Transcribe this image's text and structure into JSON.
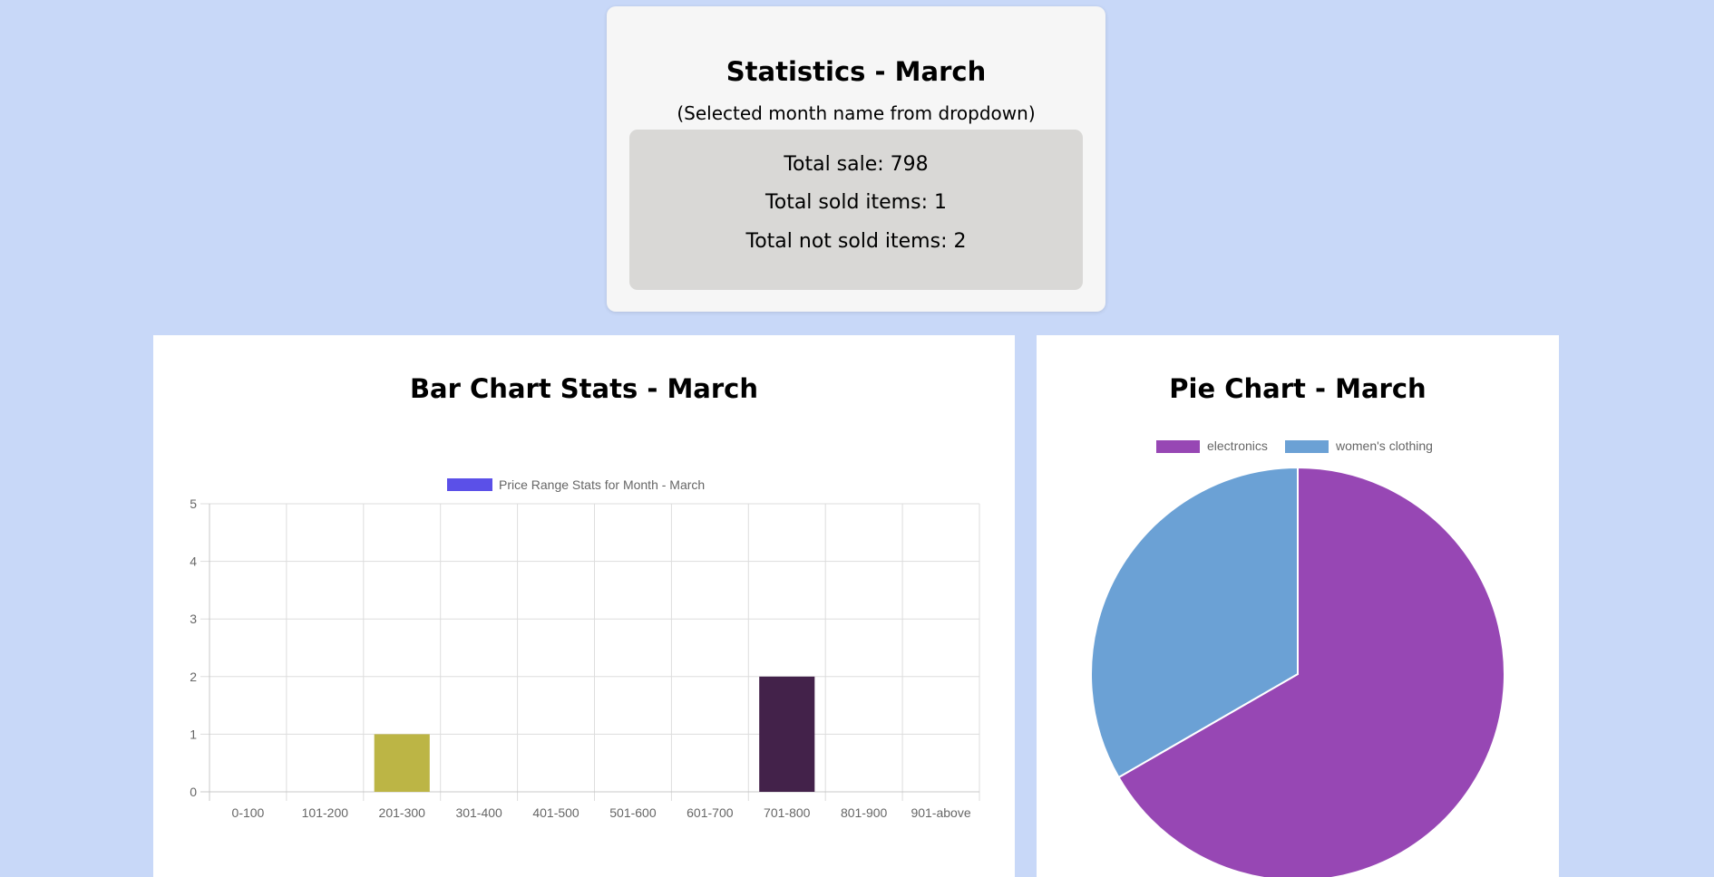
{
  "stats": {
    "title": "Statistics - March",
    "subtitle": "(Selected month name from dropdown)",
    "total_sale": "Total sale: 798",
    "total_sold": "Total sold items: 1",
    "total_not_sold": "Total not sold items: 2"
  },
  "bar_panel": {
    "title": "Bar Chart Stats - March"
  },
  "pie_panel": {
    "title": "Pie Chart - March"
  },
  "colors": {
    "page_background": "#c8d8f8",
    "legend_swatch": "#5b50e8",
    "bar_201_300": "#bcb545",
    "bar_701_800": "#43224a",
    "pie_electronics": "#9747b4",
    "pie_womens_clothing": "#6ba1d5",
    "grid": "#dddddd",
    "axis_text": "#666666"
  },
  "chart_data": [
    {
      "type": "bar",
      "legend": "Price Range Stats for Month - March",
      "categories": [
        "0-100",
        "101-200",
        "201-300",
        "301-400",
        "401-500",
        "501-600",
        "601-700",
        "701-800",
        "801-900",
        "901-above"
      ],
      "values": [
        0,
        0,
        1,
        0,
        0,
        0,
        0,
        2,
        0,
        0
      ],
      "bar_colors": [
        "#5b50e8",
        "#5b50e8",
        "#bcb545",
        "#5b50e8",
        "#5b50e8",
        "#5b50e8",
        "#5b50e8",
        "#43224a",
        "#5b50e8",
        "#5b50e8"
      ],
      "yticks": [
        "0",
        "1",
        "2",
        "3",
        "4",
        "5"
      ],
      "ylim": [
        0,
        5
      ],
      "grid": true,
      "legend_position": "top"
    },
    {
      "type": "pie",
      "labels": [
        "electronics",
        "women's clothing"
      ],
      "values": [
        2,
        1
      ],
      "colors": [
        "#9747b4",
        "#6ba1d5"
      ],
      "legend_position": "top"
    }
  ]
}
